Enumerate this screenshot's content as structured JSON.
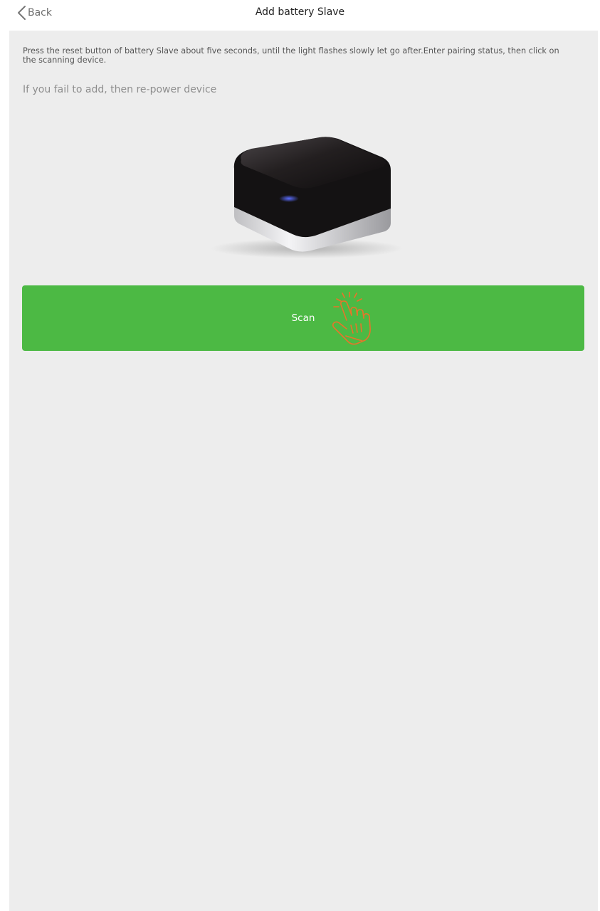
{
  "header": {
    "back_label": "Back",
    "title": "Add battery Slave"
  },
  "main": {
    "instructions": "Press the reset button of battery Slave about five seconds, until the light flashes slowly let go after.Enter pairing status, then click on the scanning device.",
    "hint": "If you fail to add, then re-power device",
    "scan_button": {
      "label": "Scan",
      "color": "#4cb944"
    },
    "hand_icon_color": "#e8742a"
  }
}
